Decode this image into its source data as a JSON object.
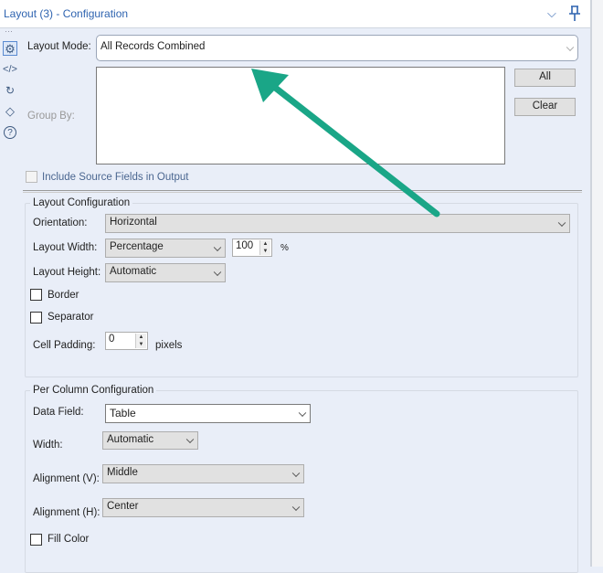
{
  "header": {
    "title": "Layout (3) - Configuration"
  },
  "sidebar_icons": [
    "gear-icon",
    "code-icon",
    "connection-icon",
    "tag-icon",
    "help-icon"
  ],
  "layout_mode": {
    "label": "Layout Mode:",
    "value": "All Records Combined"
  },
  "group_by": {
    "label": "Group By:",
    "all_label": "All",
    "clear_label": "Clear"
  },
  "include_source": {
    "label": "Include Source Fields in Output",
    "checked": false
  },
  "layout_config": {
    "title": "Layout Configuration",
    "orientation": {
      "label": "Orientation:",
      "value": "Horizontal"
    },
    "width": {
      "label": "Layout Width:",
      "value": "Percentage",
      "amount": "100",
      "unit": "%"
    },
    "height": {
      "label": "Layout Height:",
      "value": "Automatic"
    },
    "border": {
      "label": "Border",
      "checked": false
    },
    "separator": {
      "label": "Separator",
      "checked": false
    },
    "cell_padding": {
      "label": "Cell Padding:",
      "value": "0",
      "unit": "pixels"
    }
  },
  "per_column": {
    "title": "Per Column Configuration",
    "data_field": {
      "label": "Data Field:",
      "value": "Table"
    },
    "width": {
      "label": "Width:",
      "value": "Automatic"
    },
    "align_v": {
      "label": "Alignment (V):",
      "value": "Middle"
    },
    "align_h": {
      "label": "Alignment (H):",
      "value": "Center"
    },
    "fill_color": {
      "label": "Fill Color",
      "checked": false
    }
  },
  "colors": {
    "accent": "#2f64b0",
    "annotation_arrow": "#1aa687",
    "panel_bg": "#e9eef8"
  }
}
